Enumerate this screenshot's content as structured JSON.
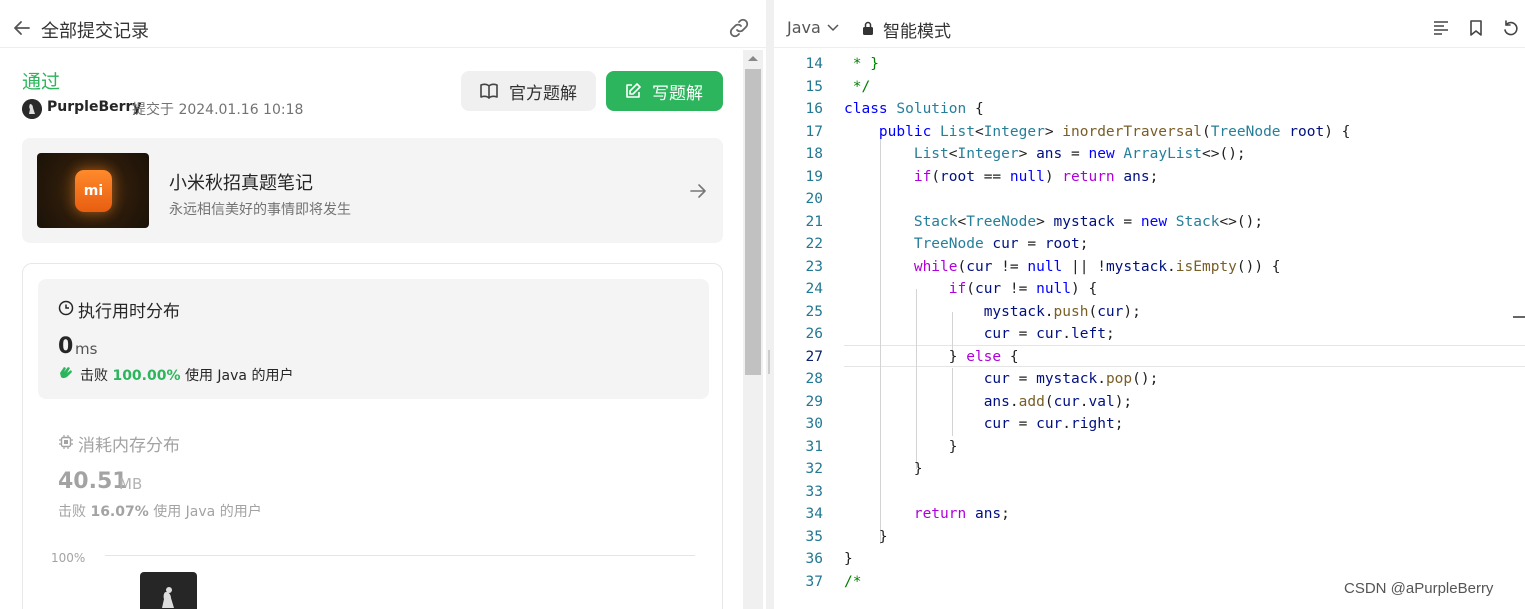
{
  "left": {
    "title": "全部提交记录",
    "status": "通过",
    "submitter": "PurpleBerry",
    "submit_info": "提交于 2024.01.16 10:18",
    "official_btn": "官方题解",
    "write_btn": "写题解",
    "promo": {
      "logo_text": "mi",
      "title": "小米秋招真题笔记",
      "subtitle": "永远相信美好的事情即将发生"
    },
    "runtime": {
      "title": "执行用时分布",
      "value": "0",
      "unit": "ms",
      "beat_prefix": "击败",
      "beat_pct": "100.00%",
      "beat_suffix": "使用 Java 的用户"
    },
    "memory": {
      "title": "消耗内存分布",
      "value": "40.51",
      "unit": "MB",
      "beat_prefix": "击败",
      "beat_pct": "16.07%",
      "beat_suffix": "使用 Java 的用户"
    },
    "chart": {
      "y_label": "100%"
    }
  },
  "right": {
    "language": "Java",
    "mode": "智能模式",
    "watermark": "CSDN @aPurpleBerry",
    "current_line": "27"
  },
  "code_lines": [
    {
      "n": "14",
      "t": " * }"
    },
    {
      "n": "15",
      "t": " */"
    },
    {
      "n": "16",
      "t": "class Solution {"
    },
    {
      "n": "17",
      "t": "    public List<Integer> inorderTraversal(TreeNode root) {"
    },
    {
      "n": "18",
      "t": "        List<Integer> ans = new ArrayList<>();"
    },
    {
      "n": "19",
      "t": "        if(root == null) return ans;"
    },
    {
      "n": "20",
      "t": ""
    },
    {
      "n": "21",
      "t": "        Stack<TreeNode> mystack = new Stack<>();"
    },
    {
      "n": "22",
      "t": "        TreeNode cur = root;"
    },
    {
      "n": "23",
      "t": "        while(cur != null || !mystack.isEmpty()) {"
    },
    {
      "n": "24",
      "t": "            if(cur != null) {"
    },
    {
      "n": "25",
      "t": "                mystack.push(cur);"
    },
    {
      "n": "26",
      "t": "                cur = cur.left;"
    },
    {
      "n": "27",
      "t": "            } else {"
    },
    {
      "n": "28",
      "t": "                cur = mystack.pop();"
    },
    {
      "n": "29",
      "t": "                ans.add(cur.val);"
    },
    {
      "n": "30",
      "t": "                cur = cur.right;"
    },
    {
      "n": "31",
      "t": "            }"
    },
    {
      "n": "32",
      "t": "        }"
    },
    {
      "n": "33",
      "t": ""
    },
    {
      "n": "34",
      "t": "        return ans;"
    },
    {
      "n": "35",
      "t": "    }"
    },
    {
      "n": "36",
      "t": "}"
    },
    {
      "n": "37",
      "t": "/*"
    }
  ],
  "colors": {
    "accent_green": "#2db55d",
    "keyword": "#0000ff",
    "control": "#af00db",
    "type": "#267f99",
    "comment": "#008000",
    "line_number": "#237893"
  }
}
